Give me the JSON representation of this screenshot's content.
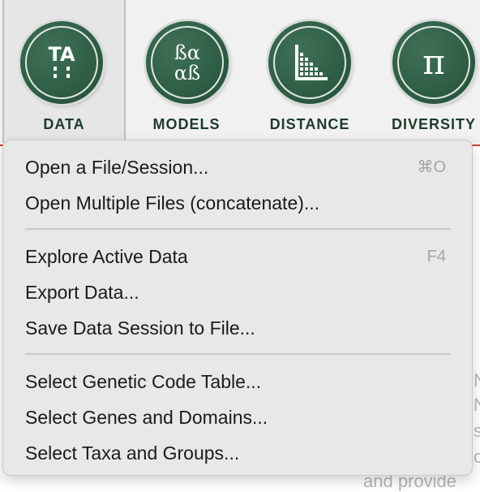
{
  "toolbar": {
    "buttons": [
      {
        "label": "DATA",
        "icon": "ta-icon",
        "glyph": "TA",
        "active": true
      },
      {
        "label": "MODELS",
        "icon": "greek-letters-icon",
        "glyph": "ßα αß",
        "active": false
      },
      {
        "label": "DISTANCE",
        "icon": "distance-matrix-icon",
        "glyph": "",
        "active": false
      },
      {
        "label": "DIVERSITY",
        "icon": "pi-icon",
        "glyph": "π",
        "active": false
      }
    ],
    "accent_color": "#2e5d44",
    "underline_color": "#c9402a"
  },
  "menu": {
    "group1": [
      {
        "label": "Open a File/Session...",
        "shortcut": "⌘O"
      },
      {
        "label": "Open Multiple Files (concatenate)...",
        "shortcut": ""
      }
    ],
    "group2": [
      {
        "label": "Explore Active Data",
        "shortcut": "F4"
      },
      {
        "label": "Export Data...",
        "shortcut": ""
      },
      {
        "label": "Save Data Session to File...",
        "shortcut": ""
      }
    ],
    "group3": [
      {
        "label": "Select Genetic Code Table...",
        "shortcut": ""
      },
      {
        "label": "Select Genes and Domains...",
        "shortcut": ""
      },
      {
        "label": "Select Taxa and Groups...",
        "shortcut": ""
      }
    ]
  },
  "background": {
    "fragments": [
      "N",
      "N",
      "s",
      "c",
      "and provide"
    ]
  }
}
